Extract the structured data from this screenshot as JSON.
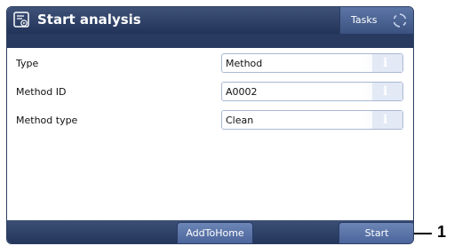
{
  "window": {
    "title": "Start analysis",
    "title_icon": "document-play-icon",
    "tasks_label": "Tasks",
    "sync_icon": "sync-icon"
  },
  "rows": [
    {
      "label": "Type",
      "value": "Method",
      "info": "i"
    },
    {
      "label": "Method ID",
      "value": "A0002",
      "info": "i"
    },
    {
      "label": "Method type",
      "value": "Clean",
      "info": "i"
    }
  ],
  "bottom": {
    "add_to_home_label": "AddToHome",
    "start_label": "Start"
  },
  "callout": {
    "number": "1"
  },
  "colors": {
    "title_bar": "#2d3f66",
    "button": "#5a73a8",
    "field_border": "#a9b8d2"
  }
}
